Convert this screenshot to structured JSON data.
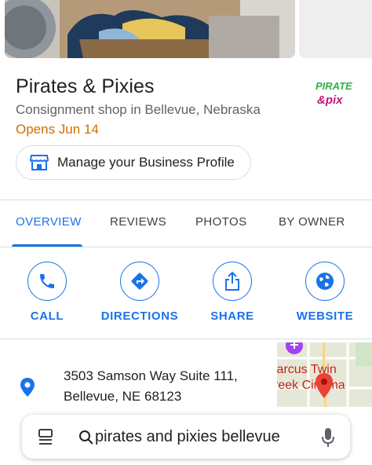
{
  "business": {
    "name": "Pirates & Pixies",
    "category": "Consignment shop in Bellevue, Nebraska",
    "hours_status": "Opens Jun 14",
    "logo_text_top": "PIRATE",
    "logo_text_bottom": "&pix"
  },
  "manage_button": {
    "label": "Manage your Business Profile",
    "icon": "storefront-icon"
  },
  "tabs": [
    {
      "label": "OVERVIEW",
      "active": true
    },
    {
      "label": "REVIEWS",
      "active": false
    },
    {
      "label": "PHOTOS",
      "active": false
    },
    {
      "label": "BY OWNER",
      "active": false
    }
  ],
  "actions": [
    {
      "label": "CALL",
      "icon": "phone-icon"
    },
    {
      "label": "DIRECTIONS",
      "icon": "directions-icon"
    },
    {
      "label": "SHARE",
      "icon": "share-icon"
    },
    {
      "label": "WEBSITE",
      "icon": "globe-icon"
    }
  ],
  "address": {
    "line1": "3503 Samson Way Suite 111,",
    "line2": "Bellevue, NE 68123"
  },
  "map": {
    "label_line1": "larcus Twin",
    "label_line2": "reek Cinema"
  },
  "search": {
    "query": "pirates and pixies bellevue"
  },
  "colors": {
    "accent": "#1a73e8",
    "hours": "#d16d00",
    "pin": "#ea4335"
  }
}
